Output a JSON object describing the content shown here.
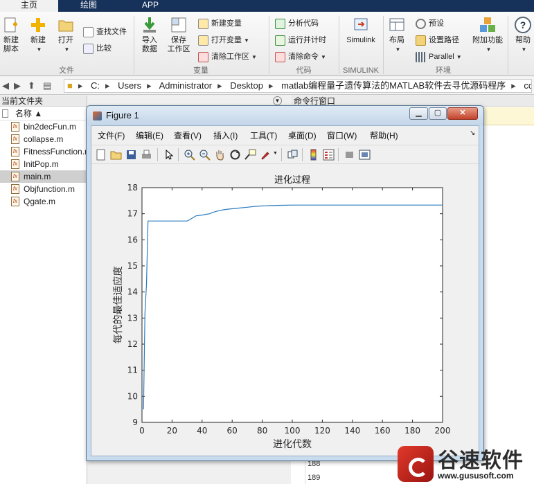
{
  "ribbon": {
    "tabs": [
      {
        "label": "主页",
        "active": true
      },
      {
        "label": "绘图",
        "active": false
      },
      {
        "label": "APP",
        "active": false
      }
    ],
    "groups": {
      "file": "文件",
      "variable": "变量",
      "code": "代码",
      "simulink": "SIMULINK",
      "environment": "环境"
    },
    "buttons": {
      "new_script": "新建\n脚本",
      "new": "新建",
      "open": "打开",
      "find_files": "查找文件",
      "compare": "比较",
      "import_data": "导入\n数据",
      "save_workspace": "保存\n工作区",
      "new_variable": "新建变量",
      "open_variable": "打开变量",
      "clear_workspace": "清除工作区",
      "analyze_code": "分析代码",
      "run_and_time": "运行并计时",
      "clear_commands": "清除命令",
      "simulink": "Simulink",
      "layout": "布局",
      "preferences": "预设",
      "set_path": "设置路径",
      "parallel": "Parallel",
      "add_ons": "附加功能",
      "help": "帮助"
    }
  },
  "address": {
    "path": [
      "C:",
      "Users",
      "Administrator",
      "Desktop",
      "matlab编程量子遗传算法的MATLAB软件去寻优源码程序",
      "code"
    ]
  },
  "current_folder": {
    "title": "当前文件夹",
    "column": "名称 ▲",
    "files": [
      {
        "name": "bin2decFun.m",
        "selected": false
      },
      {
        "name": "collapse.m",
        "selected": false
      },
      {
        "name": "FitnessFunction.m",
        "selected": false
      },
      {
        "name": "InitPop.m",
        "selected": false
      },
      {
        "name": "main.m",
        "selected": true
      },
      {
        "name": "Objfunction.m",
        "selected": false
      },
      {
        "name": "Qgate.m",
        "selected": false
      }
    ]
  },
  "command_window": {
    "title": "命令行窗口",
    "line_numbers": [
      "188",
      "189"
    ]
  },
  "figure": {
    "title": "Figure 1",
    "menus": [
      "文件(F)",
      "编辑(E)",
      "查看(V)",
      "插入(I)",
      "工具(T)",
      "桌面(D)",
      "窗口(W)",
      "帮助(H)"
    ],
    "toolbar_icons": [
      "new-figure-icon",
      "open-file-icon",
      "save-icon",
      "print-icon",
      "pointer-icon",
      "zoom-in-icon",
      "zoom-out-icon",
      "pan-icon",
      "rotate-icon",
      "data-cursor-icon",
      "brush-icon",
      "link-icon",
      "colorbar-icon",
      "legend-icon",
      "hide-plot-tools-icon",
      "show-plot-tools-icon"
    ]
  },
  "chart_data": {
    "type": "line",
    "title": "进化过程",
    "xlabel": "进化代数",
    "ylabel": "每代的最佳适应度",
    "xlim": [
      0,
      200
    ],
    "ylim": [
      9,
      18
    ],
    "xticks": [
      0,
      20,
      40,
      60,
      80,
      100,
      120,
      140,
      160,
      180,
      200
    ],
    "yticks": [
      9,
      10,
      11,
      12,
      13,
      14,
      15,
      16,
      17,
      18
    ],
    "grid": false,
    "color": "#2b7bbf",
    "series": [
      {
        "x": [
          1,
          2,
          3,
          4,
          5,
          6,
          30,
          32,
          34,
          36,
          40,
          43,
          45,
          47,
          50,
          54,
          58,
          62,
          65,
          70,
          75,
          80,
          85,
          90,
          100,
          120,
          140,
          160,
          180,
          200
        ],
        "values": [
          9.5,
          13.2,
          14.3,
          16.72,
          16.72,
          16.72,
          16.72,
          16.78,
          16.85,
          16.92,
          16.95,
          16.98,
          17.0,
          17.05,
          17.1,
          17.15,
          17.18,
          17.2,
          17.22,
          17.25,
          17.28,
          17.3,
          17.31,
          17.32,
          17.33,
          17.33,
          17.33,
          17.33,
          17.33,
          17.33
        ]
      }
    ]
  },
  "watermark": {
    "name": "谷速软件",
    "url": "www.gususoft.com"
  }
}
